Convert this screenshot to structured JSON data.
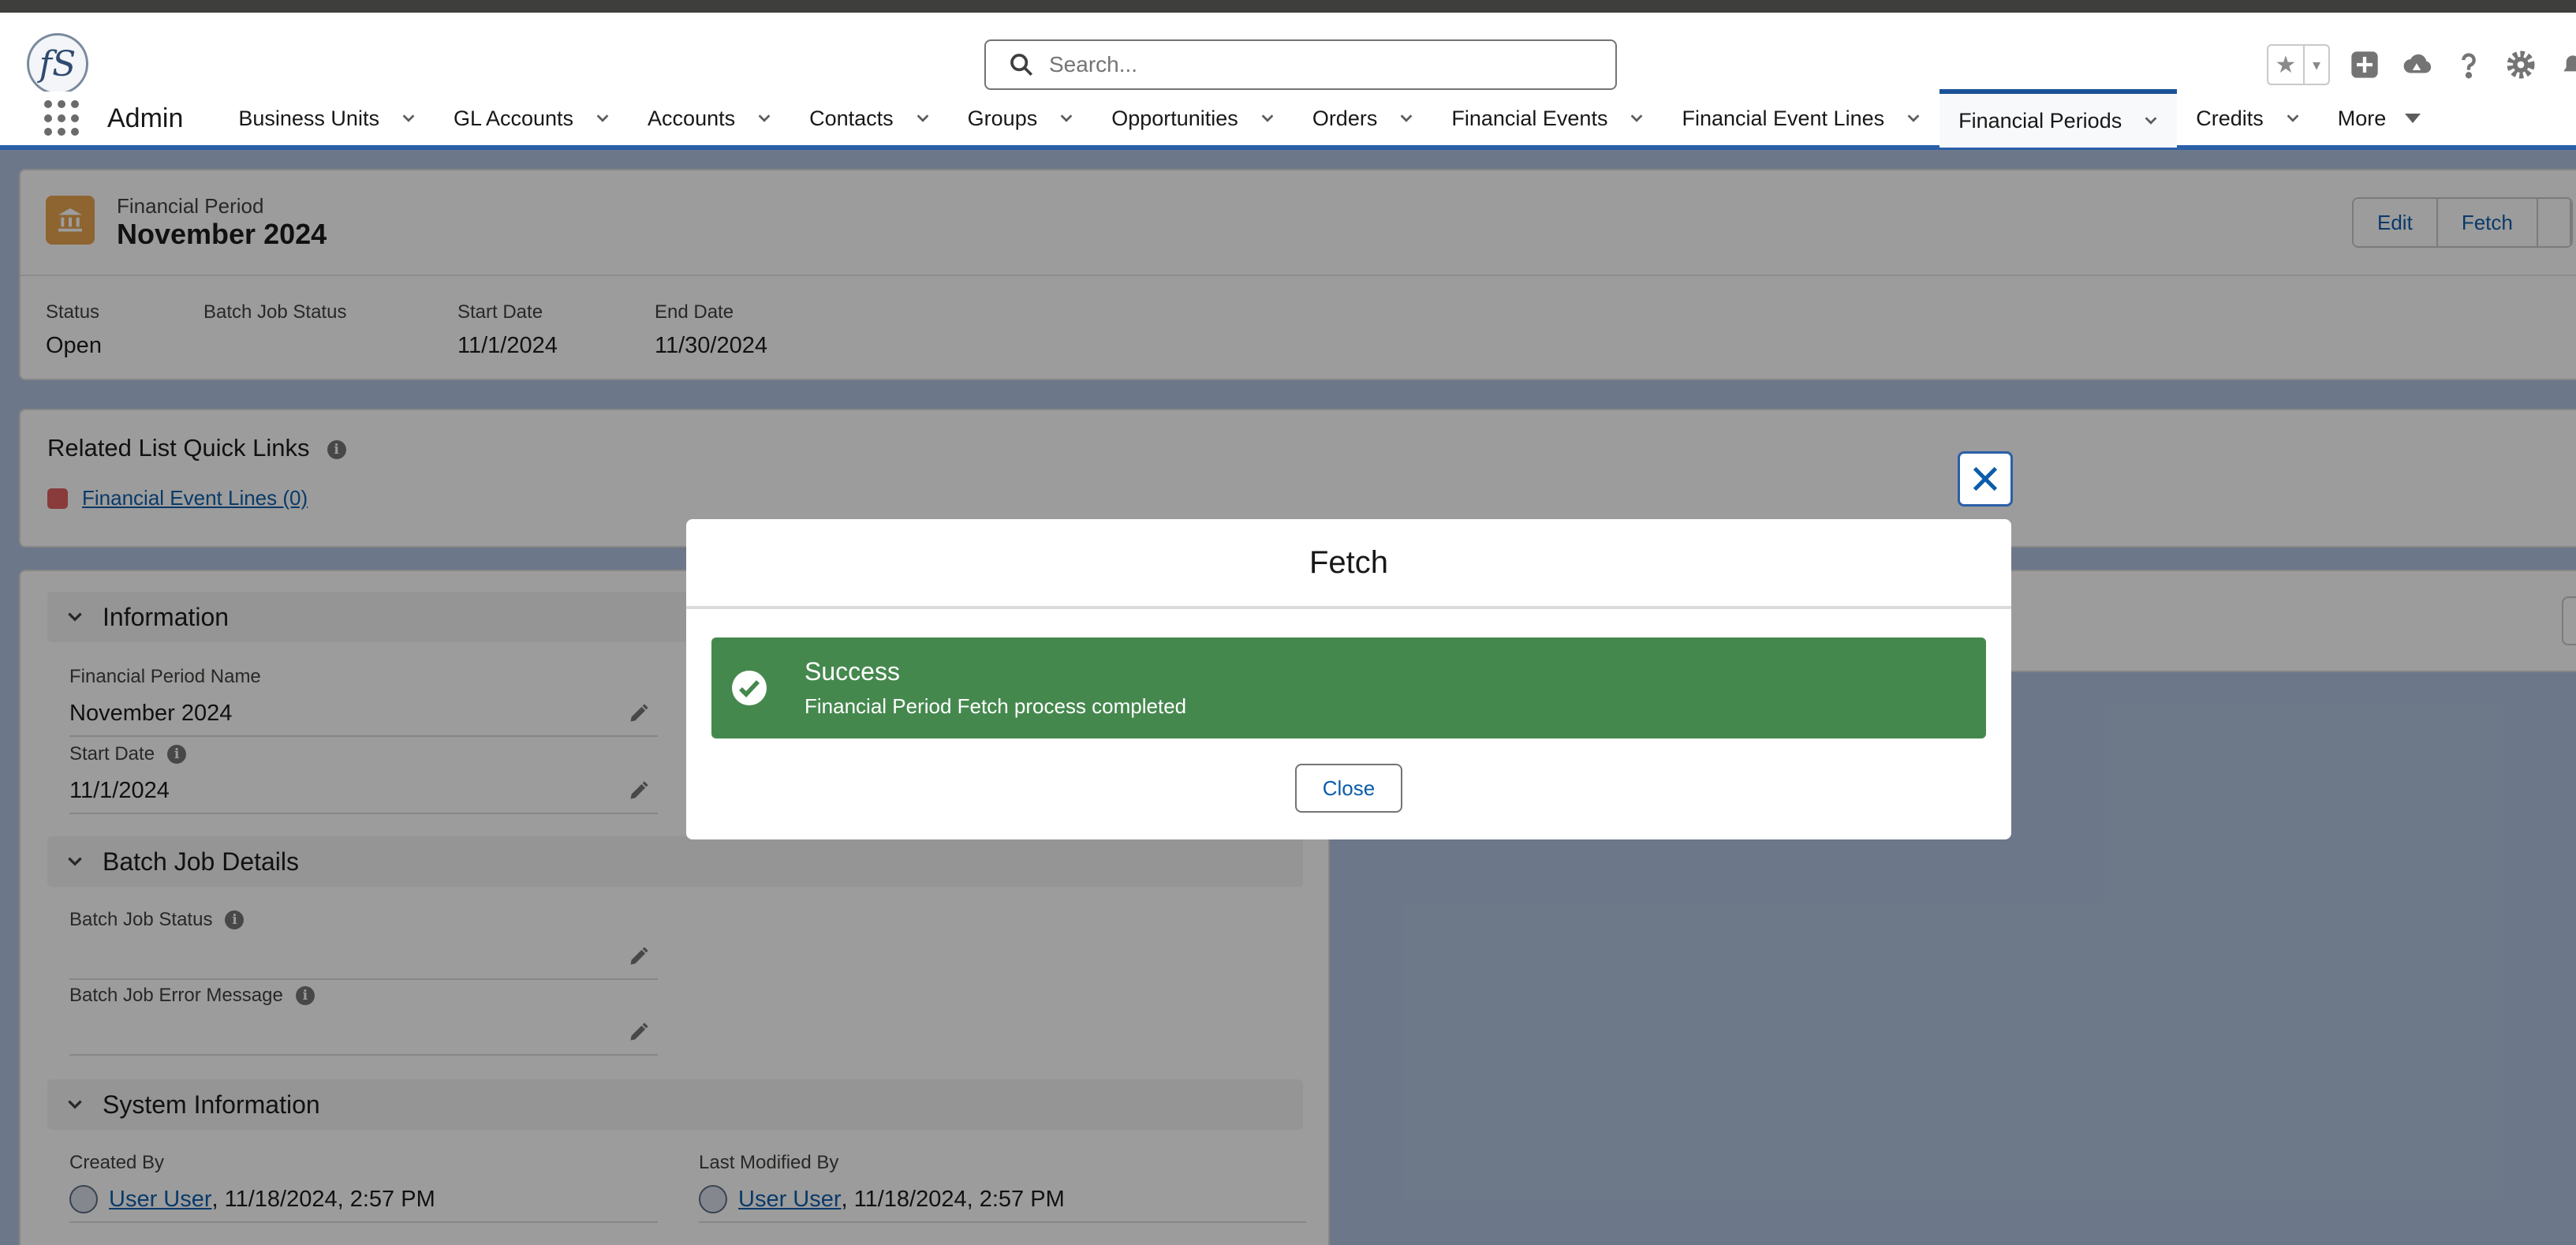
{
  "header": {
    "logo_text": "fS",
    "search_placeholder": "Search...",
    "icons": [
      "favorite-star-icon",
      "favorites-dropdown-icon",
      "global-add-icon",
      "trailhead-icon",
      "help-icon",
      "setup-gear-icon",
      "notification-bell-icon"
    ]
  },
  "nav": {
    "app_name": "Admin",
    "items": [
      {
        "label": "Business Units"
      },
      {
        "label": "GL Accounts"
      },
      {
        "label": "Accounts"
      },
      {
        "label": "Contacts"
      },
      {
        "label": "Groups"
      },
      {
        "label": "Opportunities"
      },
      {
        "label": "Orders"
      },
      {
        "label": "Financial Events"
      },
      {
        "label": "Financial Event Lines"
      },
      {
        "label": "Financial Periods"
      },
      {
        "label": "Credits"
      }
    ],
    "more_label": "More",
    "active_item": "Financial Periods"
  },
  "record": {
    "object_label": "Financial Period",
    "title": "November 2024",
    "actions": [
      "Edit",
      "Fetch"
    ],
    "highlights": [
      {
        "label": "Status",
        "value": "Open"
      },
      {
        "label": "Batch Job Status",
        "value": ""
      },
      {
        "label": "Start Date",
        "value": "11/1/2024"
      },
      {
        "label": "End Date",
        "value": "11/30/2024"
      }
    ]
  },
  "related_quick_links": {
    "title": "Related List Quick Links",
    "links": [
      {
        "label": "Financial Event Lines (0)"
      }
    ]
  },
  "sections": {
    "information": {
      "title": "Information",
      "fields": [
        {
          "label": "Financial Period Name",
          "value": "November 2024"
        },
        {
          "label": "Start Date",
          "value": "11/1/2024"
        }
      ]
    },
    "batch": {
      "title": "Batch Job Details",
      "fields": [
        {
          "label": "Batch Job Status",
          "value": ""
        },
        {
          "label": "Batch Job Error Message",
          "value": ""
        }
      ]
    },
    "system": {
      "title": "System Information",
      "created_by_label": "Created By",
      "created_by_user": "User User",
      "created_by_date": ", 11/18/2024, 2:57 PM",
      "modified_by_label": "Last Modified By",
      "modified_by_user": "User User",
      "modified_by_date": ", 11/18/2024, 2:57 PM"
    }
  },
  "modal": {
    "title": "Fetch",
    "toast_title": "Success",
    "toast_message": "Financial Period Fetch process completed",
    "close_label": "Close",
    "toast_color": "#45884e"
  },
  "colors": {
    "brand_blue": "#0b5cab",
    "nav_active_border": "#1b5297",
    "record_icon": "#e8a24e"
  }
}
